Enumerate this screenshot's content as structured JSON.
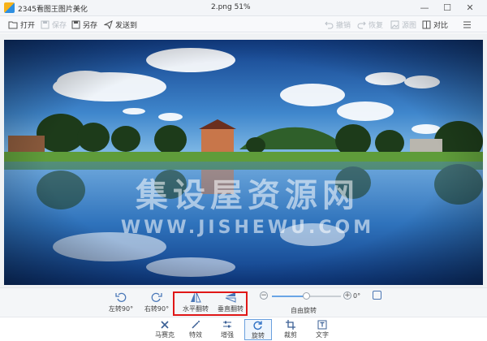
{
  "window": {
    "app_title": "2345看图王图片美化",
    "file_title": "2.png  51%"
  },
  "toolbar": {
    "open": "打开",
    "save": "保存",
    "save_as": "另存",
    "send_to": "发送到",
    "undo": "撤销",
    "redo": "恢复",
    "compare_src": "源图",
    "compare": "对比"
  },
  "image": {
    "watermark_cn": "集设屋资源网",
    "watermark_en": "WWW.JISHEWU.COM",
    "colors": {
      "sky_top": "#1d4f9e",
      "sky_mid": "#3f84c9",
      "water": "#2b6fb5",
      "grass": "#5f9c3a"
    }
  },
  "controls": {
    "rotate_left": "左转90°",
    "rotate_right": "右转90°",
    "flip_horizontal": "水平翻转",
    "flip_vertical": "垂直翻转",
    "rotation_value": "0°",
    "rotation_fraction": 0.5,
    "free_rotate": "自由旋转",
    "minus": "−",
    "plus": "+",
    "highlight_color": "#e01717"
  },
  "tabs": [
    {
      "label": "马赛克",
      "icon": "mosaic-icon"
    },
    {
      "label": "特效",
      "icon": "magic-wand-icon"
    },
    {
      "label": "增强",
      "icon": "sliders-icon"
    },
    {
      "label": "旋转",
      "icon": "rotate-icon",
      "active": true
    },
    {
      "label": "裁剪",
      "icon": "crop-icon"
    },
    {
      "label": "文字",
      "icon": "text-icon"
    }
  ]
}
